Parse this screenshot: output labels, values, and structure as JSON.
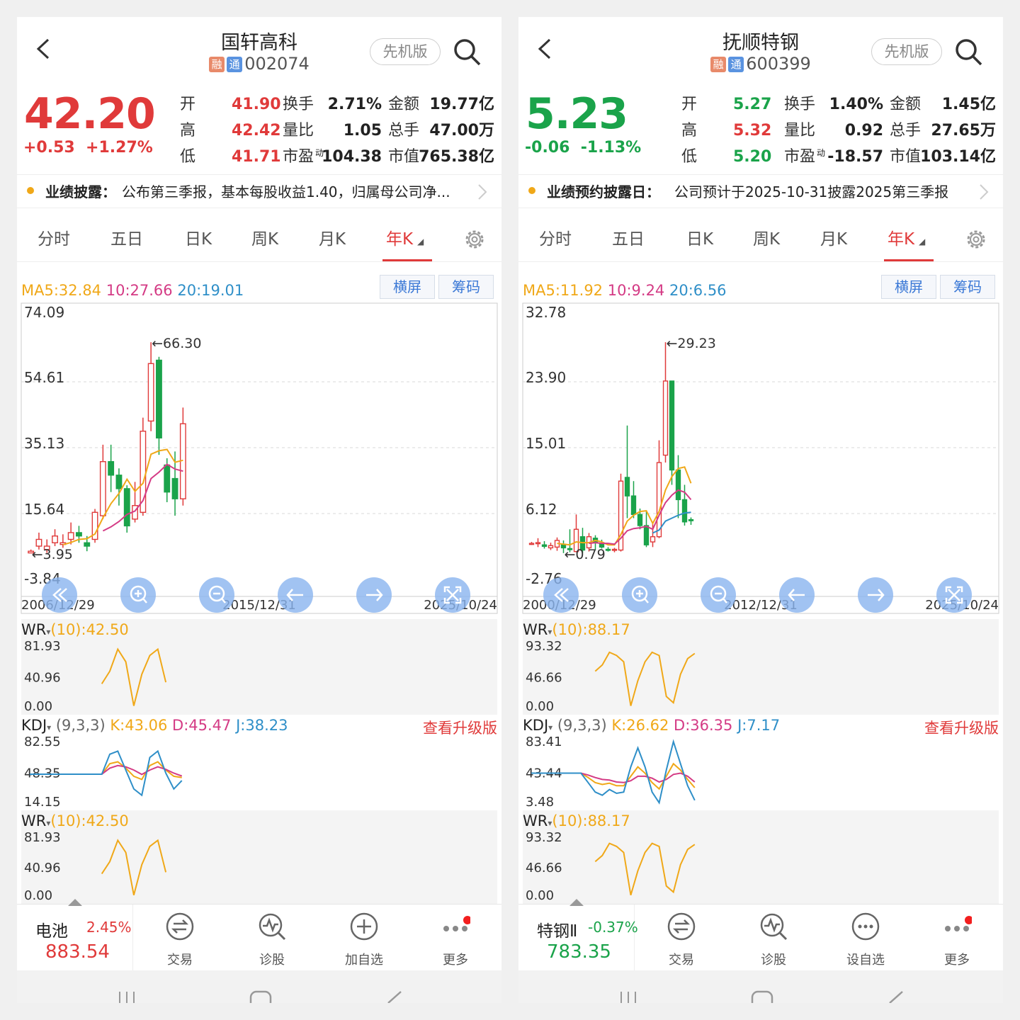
{
  "colors": {
    "red": "#e03a3a",
    "green": "#1aa34a",
    "ma5": "#f0a818",
    "ma10": "#d43b85",
    "ma20": "#2f8fc8",
    "blue": "#3a78d6",
    "orange": "#f0a818",
    "grid": "#d8d8d8"
  },
  "icons": [
    "back-arrow-icon",
    "search-icon",
    "settings-gear-icon",
    "zoom-in-icon",
    "zoom-out-icon",
    "left-arrow-icon",
    "right-arrow-icon",
    "fullscreen-icon",
    "trade-icon",
    "diagnose-icon",
    "add-watch-icon",
    "more-icon"
  ],
  "panels": [
    {
      "header": {
        "name": "国轩高科",
        "badge1": "融",
        "badge2": "通",
        "code": "002074",
        "pill": "先机版"
      },
      "quote": {
        "price": "42.20",
        "change": "+0.53",
        "pct": "+1.27%",
        "dir": "up",
        "rows": [
          {
            "l1": "开",
            "v1": "41.90",
            "l2": "换手",
            "v2": "2.71%",
            "l3": "金额",
            "v3": "19.77亿"
          },
          {
            "l1": "高",
            "v1": "42.42",
            "l2": "量比",
            "v2": "1.05",
            "l3": "总手",
            "v3": "47.00万"
          },
          {
            "l1": "低",
            "v1": "41.71",
            "l2": "市盈",
            "l2sup": "动",
            "v2": "104.38",
            "l3": "市值",
            "v3": "765.38亿"
          }
        ]
      },
      "notice": {
        "label": "业绩披露：",
        "text": "公布第三季报，基本每股收益1.40，归属母公司净..."
      },
      "tabs": [
        "分时",
        "五日",
        "日K",
        "周K",
        "月K",
        "年K"
      ],
      "ma_legend": {
        "ma5": "MA5:32.84",
        "ma10": "10:27.66",
        "ma20": "20:19.01"
      },
      "buttons": {
        "landscape": "横屏",
        "chips": "筹码"
      },
      "chart_data": {
        "type": "candlestick",
        "ylim": [
          -3.84,
          74.09
        ],
        "y_ticks": [
          "74.09",
          "54.61",
          "35.13",
          "15.64",
          "-3.84"
        ],
        "x_labels": [
          "2006/12/29",
          "2015/12/31",
          "2025/10/24"
        ],
        "high_label": "←66.30",
        "low_label": "←3.95",
        "bar_count": 20,
        "candles": [
          {
            "o": 4,
            "c": 4.5,
            "h": 5,
            "l": 3.95
          },
          {
            "o": 6,
            "c": 8,
            "h": 10,
            "l": 5
          },
          {
            "o": 5,
            "c": 6,
            "h": 8,
            "l": 4
          },
          {
            "o": 7,
            "c": 9,
            "h": 11,
            "l": 6
          },
          {
            "o": 6.5,
            "c": 7,
            "h": 9.5,
            "l": 5.5
          },
          {
            "o": 8,
            "c": 10,
            "h": 13,
            "l": 6.5
          },
          {
            "o": 10,
            "c": 9,
            "h": 12,
            "l": 7
          },
          {
            "o": 7,
            "c": 6,
            "h": 9,
            "l": 4.5
          },
          {
            "o": 8,
            "c": 16,
            "h": 17,
            "l": 7
          },
          {
            "o": 15,
            "c": 31,
            "h": 36,
            "l": 14
          },
          {
            "o": 31,
            "c": 27,
            "h": 36,
            "l": 22
          },
          {
            "o": 27,
            "c": 23,
            "h": 29,
            "l": 18
          },
          {
            "o": 23,
            "c": 12,
            "h": 24,
            "l": 10
          },
          {
            "o": 14,
            "c": 18,
            "h": 25,
            "l": 13
          },
          {
            "o": 16,
            "c": 40,
            "h": 44,
            "l": 15
          },
          {
            "o": 43,
            "c": 60,
            "h": 66.3,
            "l": 40
          },
          {
            "o": 61,
            "c": 38,
            "h": 62,
            "l": 33
          },
          {
            "o": 30,
            "c": 22,
            "h": 32,
            "l": 19
          },
          {
            "o": 26,
            "c": 20,
            "h": 34,
            "l": 15
          },
          {
            "o": 20,
            "c": 42.2,
            "h": 47,
            "l": 18
          }
        ],
        "ma5": [
          null,
          null,
          null,
          null,
          6.4,
          7.1,
          8.0,
          8.2,
          9.6,
          14.4,
          18.6,
          21.6,
          25.8,
          22.2,
          24.6,
          33.2,
          34.2,
          34.6,
          30.8,
          31.4
        ],
        "ma10": [
          null,
          null,
          null,
          null,
          null,
          null,
          null,
          null,
          null,
          10.5,
          11.7,
          13.3,
          15.4,
          16.4,
          19.5,
          26.0,
          27.9,
          30.2,
          28.8,
          28.2
        ],
        "ma20": [
          null,
          null,
          null,
          null,
          null,
          null,
          null,
          null,
          null,
          null,
          null,
          null,
          null,
          null,
          null,
          null,
          null,
          null,
          null,
          25.1
        ]
      },
      "wr1": {
        "name": "WR",
        "param": "(10):42.50",
        "ticks": [
          "81.93",
          "40.96",
          "0.00"
        ],
        "series": [
          null,
          null,
          null,
          null,
          null,
          null,
          null,
          null,
          null,
          40,
          60,
          95,
          75,
          5,
          55,
          85,
          95,
          42.5
        ]
      },
      "kdj": {
        "name": "KDJ",
        "param": "(9,3,3)",
        "k": "K:43.06",
        "d": "D:45.47",
        "j": "J:38.23",
        "upgrade": "查看升级版",
        "ticks": [
          "82.55",
          "48.35",
          "14.15"
        ],
        "K": [
          48.35,
          48.35,
          48.35,
          48.35,
          48.35,
          48.35,
          48.35,
          48.35,
          48.35,
          48.35,
          65,
          68,
          58,
          45,
          40,
          62,
          68,
          55,
          45,
          43
        ],
        "D": [
          48.35,
          48.35,
          48.35,
          48.35,
          48.35,
          48.35,
          48.35,
          48.35,
          48.35,
          48.35,
          58,
          62,
          60,
          55,
          48,
          55,
          60,
          56,
          50,
          45.5
        ],
        "J": [
          48.35,
          48.35,
          48.35,
          48.35,
          48.35,
          48.35,
          48.35,
          48.35,
          48.35,
          48.35,
          80,
          85,
          55,
          25,
          15,
          75,
          85,
          50,
          25,
          38.2
        ]
      },
      "wr2": {
        "name": "WR",
        "param": "(10):42.50",
        "ticks": [
          "81.93",
          "40.96",
          "0.00"
        ],
        "series": [
          null,
          null,
          null,
          null,
          null,
          null,
          null,
          null,
          null,
          40,
          60,
          95,
          75,
          5,
          55,
          85,
          95,
          42.5
        ]
      },
      "bottom": {
        "idx_name": "电池",
        "idx_pct": "2.45%",
        "idx_val": "883.54",
        "idx_dir": "up",
        "b1": "交易",
        "b2": "诊股",
        "b3": "加自选",
        "b4": "更多"
      }
    },
    {
      "header": {
        "name": "抚顺特钢",
        "badge1": "融",
        "badge2": "通",
        "code": "600399",
        "pill": "先机版"
      },
      "quote": {
        "price": "5.23",
        "change": "-0.06",
        "pct": "-1.13%",
        "dir": "down",
        "rows": [
          {
            "l1": "开",
            "v1": "5.27",
            "l2": "换手",
            "v2": "1.40%",
            "l3": "金额",
            "v3": "1.45亿"
          },
          {
            "l1": "高",
            "v1": "5.32",
            "l2": "量比",
            "v2": "0.92",
            "l3": "总手",
            "v3": "27.65万"
          },
          {
            "l1": "低",
            "v1": "5.20",
            "l2": "市盈",
            "l2sup": "动",
            "v2": "-18.57",
            "l3": "市值",
            "v3": "103.14亿"
          }
        ]
      },
      "notice": {
        "label": "业绩预约披露日：",
        "text": "公司预计于2025-10-31披露2025第三季报"
      },
      "tabs": [
        "分时",
        "五日",
        "日K",
        "周K",
        "月K",
        "年K"
      ],
      "ma_legend": {
        "ma5": "MA5:11.92",
        "ma10": "10:9.24",
        "ma20": "20:6.56"
      },
      "buttons": {
        "landscape": "横屏",
        "chips": "筹码"
      },
      "chart_data": {
        "type": "candlestick",
        "ylim": [
          -2.76,
          32.78
        ],
        "y_ticks": [
          "32.78",
          "23.90",
          "15.01",
          "6.12",
          "-2.76"
        ],
        "x_labels": [
          "2000/12/29",
          "2012/12/31",
          "2025/10/24"
        ],
        "high_label": "←29.23",
        "low_label": "←0.79",
        "bar_count": 26,
        "candles": [
          {
            "o": 2,
            "c": 2.1,
            "h": 2.3,
            "l": 1.9
          },
          {
            "o": 2.1,
            "c": 2.2,
            "h": 2.8,
            "l": 1.6
          },
          {
            "o": 1.9,
            "c": 1.7,
            "h": 2.4,
            "l": 1.4
          },
          {
            "o": 1.5,
            "c": 1.8,
            "h": 2.2,
            "l": 1.2
          },
          {
            "o": 1.6,
            "c": 2.5,
            "h": 2.9,
            "l": 1.1
          },
          {
            "o": 2.0,
            "c": 1.5,
            "h": 2.5,
            "l": 0.79
          },
          {
            "o": 1.4,
            "c": 1.3,
            "h": 4.0,
            "l": 0.9
          },
          {
            "o": 1.0,
            "c": 4.0,
            "h": 6.0,
            "l": 0.9
          },
          {
            "o": 3.0,
            "c": 1.2,
            "h": 4.2,
            "l": 0.8
          },
          {
            "o": 1.5,
            "c": 3.0,
            "h": 3.5,
            "l": 1.0
          },
          {
            "o": 2.8,
            "c": 2.2,
            "h": 3.2,
            "l": 1.2
          },
          {
            "o": 2.0,
            "c": 1.6,
            "h": 2.6,
            "l": 1.4
          },
          {
            "o": 1.3,
            "c": 1.2,
            "h": 1.6,
            "l": 1.0
          },
          {
            "o": 1.2,
            "c": 1.3,
            "h": 1.5,
            "l": 0.9
          },
          {
            "o": 1.2,
            "c": 10.5,
            "h": 11.5,
            "l": 1.0
          },
          {
            "o": 11,
            "c": 8.5,
            "h": 18,
            "l": 5.5
          },
          {
            "o": 8.5,
            "c": 6,
            "h": 10.5,
            "l": 5.5
          },
          {
            "o": 6,
            "c": 4.5,
            "h": 6.8,
            "l": 4
          },
          {
            "o": 4.5,
            "c": 1.9,
            "h": 6.5,
            "l": 1.6
          },
          {
            "o": 2.3,
            "c": 3.0,
            "h": 5,
            "l": 1.6
          },
          {
            "o": 3.0,
            "c": 13,
            "h": 16,
            "l": 2.8
          },
          {
            "o": 14,
            "c": 24,
            "h": 29.23,
            "l": 13
          },
          {
            "o": 24,
            "c": 12,
            "h": 24,
            "l": 10
          },
          {
            "o": 12,
            "c": 8,
            "h": 14,
            "l": 5.5
          },
          {
            "o": 8,
            "c": 5,
            "h": 10,
            "l": 4.5
          },
          {
            "o": 5.3,
            "c": 5.23,
            "h": 5.6,
            "l": 4.6
          }
        ],
        "ma5": [
          null,
          null,
          null,
          null,
          2.1,
          2.0,
          1.9,
          2.3,
          2.2,
          2.2,
          2.5,
          2.3,
          1.9,
          1.9,
          3.3,
          5.1,
          5.9,
          6.4,
          6.5,
          4.8,
          6.4,
          9.3,
          11.1,
          12.2,
          12.4,
          10.2
        ],
        "ma10": [
          null,
          null,
          null,
          null,
          null,
          null,
          null,
          null,
          null,
          2.1,
          2.2,
          2.1,
          2.1,
          2.0,
          2.8,
          3.8,
          4.1,
          4.2,
          4.4,
          4.0,
          5.9,
          7.6,
          8.6,
          9.3,
          9.0,
          8.0
        ],
        "ma20": [
          null,
          null,
          null,
          null,
          null,
          null,
          null,
          null,
          null,
          null,
          null,
          null,
          null,
          null,
          null,
          null,
          null,
          null,
          null,
          3.5,
          3.9,
          5.1,
          5.5,
          5.9,
          6.2,
          6.3
        ]
      },
      "wr1": {
        "name": "WR",
        "param": "(10):88.17",
        "ticks": [
          "93.32",
          "46.66",
          "0.00"
        ],
        "series": [
          null,
          null,
          null,
          null,
          null,
          null,
          null,
          null,
          null,
          60,
          70,
          90,
          85,
          75,
          5,
          45,
          75,
          90,
          85,
          20,
          10,
          55,
          80,
          88.17
        ]
      },
      "kdj": {
        "name": "KDJ",
        "param": "(9,3,3)",
        "k": "K:26.62",
        "d": "D:36.35",
        "j": "J:7.17",
        "upgrade": "查看升级版",
        "ticks": [
          "83.41",
          "43.44",
          "3.48"
        ],
        "K": [
          50,
          50,
          50,
          50,
          50,
          50,
          50,
          50,
          43,
          35,
          32,
          34,
          30,
          30,
          45,
          60,
          50,
          35,
          25,
          45,
          65,
          55,
          40,
          27
        ],
        "D": [
          50,
          50,
          50,
          50,
          50,
          50,
          50,
          50,
          47,
          43,
          40,
          39,
          36,
          35,
          38,
          45,
          45,
          42,
          36,
          40,
          48,
          50,
          45,
          36
        ],
        "J": [
          50,
          50,
          50,
          50,
          50,
          50,
          50,
          50,
          35,
          20,
          15,
          24,
          18,
          20,
          60,
          90,
          60,
          20,
          3,
          55,
          100,
          65,
          30,
          7
        ]
      },
      "wr2": {
        "name": "WR",
        "param": "(10):88.17",
        "ticks": [
          "93.32",
          "46.66",
          "0.00"
        ],
        "series": [
          null,
          null,
          null,
          null,
          null,
          null,
          null,
          null,
          null,
          60,
          70,
          90,
          85,
          75,
          5,
          45,
          75,
          90,
          85,
          20,
          10,
          55,
          80,
          88.17
        ]
      },
      "bottom": {
        "idx_name": "特钢Ⅱ",
        "idx_pct": "-0.37%",
        "idx_val": "783.35",
        "idx_dir": "down",
        "b1": "交易",
        "b2": "诊股",
        "b3": "设自选",
        "b4": "更多"
      }
    }
  ]
}
